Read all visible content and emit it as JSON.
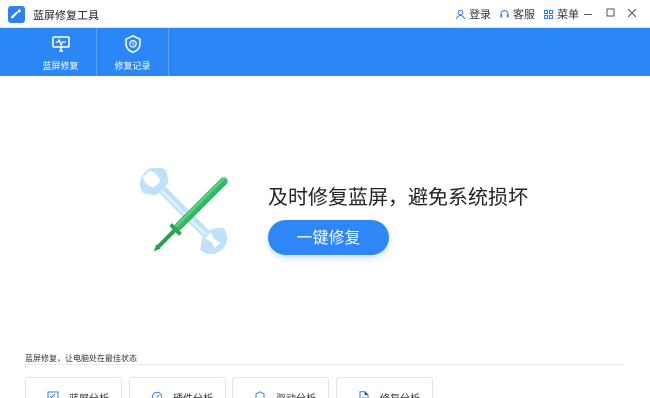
{
  "window": {
    "title": "蓝屏修复工具"
  },
  "titlebar": {
    "actions": [
      {
        "label": "登录",
        "icon": "user-icon"
      },
      {
        "label": "客服",
        "icon": "headset-icon"
      },
      {
        "label": "菜单",
        "icon": "menu-icon"
      }
    ]
  },
  "toolbar": {
    "tabs": [
      {
        "label": "蓝屏修复",
        "icon": "monitor-icon"
      },
      {
        "label": "修复记录",
        "icon": "clock-shield-icon"
      }
    ]
  },
  "main": {
    "headline": "及时修复蓝屏，避免系统损坏",
    "repair_button": "一键修复",
    "illustration_icon": "wrench-screwdriver-icon"
  },
  "status_section": {
    "title": "蓝屏修复，让电脑处在最佳状态",
    "cards": [
      {
        "label": "蓝屏分析",
        "icon": "checklist-icon"
      },
      {
        "label": "硬件分析",
        "icon": "gauge-icon"
      },
      {
        "label": "驱动分析",
        "icon": "shield-icon"
      },
      {
        "label": "修复分析",
        "icon": "document-icon"
      }
    ]
  },
  "colors": {
    "accent": "#2b86f6",
    "screwdriver": "#31b95a",
    "wrench": "#b9dcf8"
  }
}
